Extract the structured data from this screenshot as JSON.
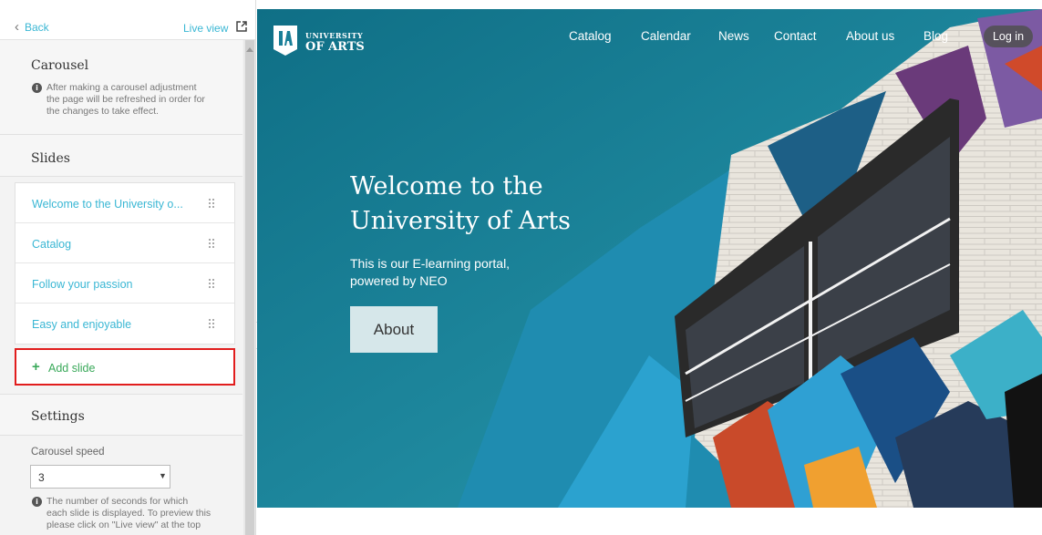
{
  "sidebar": {
    "back_label": "Back",
    "live_view_label": "Live view",
    "carousel": {
      "title": "Carousel",
      "info_lines": [
        "After making a carousel adjustment",
        "the page will be refreshed in order for",
        "the changes to take effect."
      ]
    },
    "slides": {
      "title": "Slides",
      "items": [
        {
          "label": "Welcome to the University o..."
        },
        {
          "label": "Catalog"
        },
        {
          "label": "Follow your passion"
        },
        {
          "label": "Easy and enjoyable"
        }
      ],
      "add_label": "Add slide"
    },
    "settings": {
      "title": "Settings",
      "speed_label": "Carousel speed",
      "speed_value": "3",
      "info_lines": [
        "The number of seconds for which",
        "each slide is displayed. To preview this",
        "please click on \"Live view\" at the top"
      ]
    }
  },
  "preview": {
    "logo": {
      "line1": "UNIVERSITY",
      "line2": "OF ARTS"
    },
    "nav": [
      "Catalog",
      "Calendar",
      "News",
      "Contact",
      "About us",
      "Blog"
    ],
    "login_label": "Log in",
    "hero": {
      "title_line1": "Welcome to the",
      "title_line2": "University of Arts",
      "subtitle_line1": "This is our E-learning portal,",
      "subtitle_line2": "powered by NEO",
      "button_label": "About"
    }
  },
  "colors": {
    "accent": "#3ab7d4",
    "add_green": "#3aa95a",
    "highlight_red": "#e11d1d",
    "hero_teal": "#1a7f98"
  }
}
